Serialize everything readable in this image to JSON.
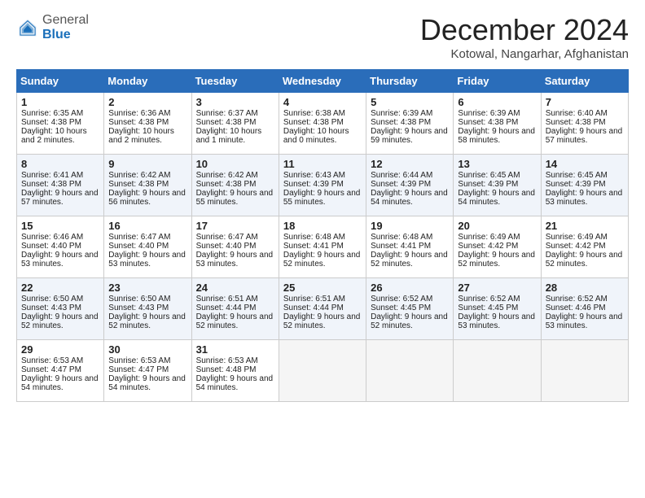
{
  "logo": {
    "general": "General",
    "blue": "Blue"
  },
  "title": "December 2024",
  "location": "Kotowal, Nangarhar, Afghanistan",
  "headers": [
    "Sunday",
    "Monday",
    "Tuesday",
    "Wednesday",
    "Thursday",
    "Friday",
    "Saturday"
  ],
  "weeks": [
    [
      {
        "day": "1",
        "sunrise": "Sunrise: 6:35 AM",
        "sunset": "Sunset: 4:38 PM",
        "daylight": "Daylight: 10 hours and 2 minutes."
      },
      {
        "day": "2",
        "sunrise": "Sunrise: 6:36 AM",
        "sunset": "Sunset: 4:38 PM",
        "daylight": "Daylight: 10 hours and 2 minutes."
      },
      {
        "day": "3",
        "sunrise": "Sunrise: 6:37 AM",
        "sunset": "Sunset: 4:38 PM",
        "daylight": "Daylight: 10 hours and 1 minute."
      },
      {
        "day": "4",
        "sunrise": "Sunrise: 6:38 AM",
        "sunset": "Sunset: 4:38 PM",
        "daylight": "Daylight: 10 hours and 0 minutes."
      },
      {
        "day": "5",
        "sunrise": "Sunrise: 6:39 AM",
        "sunset": "Sunset: 4:38 PM",
        "daylight": "Daylight: 9 hours and 59 minutes."
      },
      {
        "day": "6",
        "sunrise": "Sunrise: 6:39 AM",
        "sunset": "Sunset: 4:38 PM",
        "daylight": "Daylight: 9 hours and 58 minutes."
      },
      {
        "day": "7",
        "sunrise": "Sunrise: 6:40 AM",
        "sunset": "Sunset: 4:38 PM",
        "daylight": "Daylight: 9 hours and 57 minutes."
      }
    ],
    [
      {
        "day": "8",
        "sunrise": "Sunrise: 6:41 AM",
        "sunset": "Sunset: 4:38 PM",
        "daylight": "Daylight: 9 hours and 57 minutes."
      },
      {
        "day": "9",
        "sunrise": "Sunrise: 6:42 AM",
        "sunset": "Sunset: 4:38 PM",
        "daylight": "Daylight: 9 hours and 56 minutes."
      },
      {
        "day": "10",
        "sunrise": "Sunrise: 6:42 AM",
        "sunset": "Sunset: 4:38 PM",
        "daylight": "Daylight: 9 hours and 55 minutes."
      },
      {
        "day": "11",
        "sunrise": "Sunrise: 6:43 AM",
        "sunset": "Sunset: 4:39 PM",
        "daylight": "Daylight: 9 hours and 55 minutes."
      },
      {
        "day": "12",
        "sunrise": "Sunrise: 6:44 AM",
        "sunset": "Sunset: 4:39 PM",
        "daylight": "Daylight: 9 hours and 54 minutes."
      },
      {
        "day": "13",
        "sunrise": "Sunrise: 6:45 AM",
        "sunset": "Sunset: 4:39 PM",
        "daylight": "Daylight: 9 hours and 54 minutes."
      },
      {
        "day": "14",
        "sunrise": "Sunrise: 6:45 AM",
        "sunset": "Sunset: 4:39 PM",
        "daylight": "Daylight: 9 hours and 53 minutes."
      }
    ],
    [
      {
        "day": "15",
        "sunrise": "Sunrise: 6:46 AM",
        "sunset": "Sunset: 4:40 PM",
        "daylight": "Daylight: 9 hours and 53 minutes."
      },
      {
        "day": "16",
        "sunrise": "Sunrise: 6:47 AM",
        "sunset": "Sunset: 4:40 PM",
        "daylight": "Daylight: 9 hours and 53 minutes."
      },
      {
        "day": "17",
        "sunrise": "Sunrise: 6:47 AM",
        "sunset": "Sunset: 4:40 PM",
        "daylight": "Daylight: 9 hours and 53 minutes."
      },
      {
        "day": "18",
        "sunrise": "Sunrise: 6:48 AM",
        "sunset": "Sunset: 4:41 PM",
        "daylight": "Daylight: 9 hours and 52 minutes."
      },
      {
        "day": "19",
        "sunrise": "Sunrise: 6:48 AM",
        "sunset": "Sunset: 4:41 PM",
        "daylight": "Daylight: 9 hours and 52 minutes."
      },
      {
        "day": "20",
        "sunrise": "Sunrise: 6:49 AM",
        "sunset": "Sunset: 4:42 PM",
        "daylight": "Daylight: 9 hours and 52 minutes."
      },
      {
        "day": "21",
        "sunrise": "Sunrise: 6:49 AM",
        "sunset": "Sunset: 4:42 PM",
        "daylight": "Daylight: 9 hours and 52 minutes."
      }
    ],
    [
      {
        "day": "22",
        "sunrise": "Sunrise: 6:50 AM",
        "sunset": "Sunset: 4:43 PM",
        "daylight": "Daylight: 9 hours and 52 minutes."
      },
      {
        "day": "23",
        "sunrise": "Sunrise: 6:50 AM",
        "sunset": "Sunset: 4:43 PM",
        "daylight": "Daylight: 9 hours and 52 minutes."
      },
      {
        "day": "24",
        "sunrise": "Sunrise: 6:51 AM",
        "sunset": "Sunset: 4:44 PM",
        "daylight": "Daylight: 9 hours and 52 minutes."
      },
      {
        "day": "25",
        "sunrise": "Sunrise: 6:51 AM",
        "sunset": "Sunset: 4:44 PM",
        "daylight": "Daylight: 9 hours and 52 minutes."
      },
      {
        "day": "26",
        "sunrise": "Sunrise: 6:52 AM",
        "sunset": "Sunset: 4:45 PM",
        "daylight": "Daylight: 9 hours and 52 minutes."
      },
      {
        "day": "27",
        "sunrise": "Sunrise: 6:52 AM",
        "sunset": "Sunset: 4:45 PM",
        "daylight": "Daylight: 9 hours and 53 minutes."
      },
      {
        "day": "28",
        "sunrise": "Sunrise: 6:52 AM",
        "sunset": "Sunset: 4:46 PM",
        "daylight": "Daylight: 9 hours and 53 minutes."
      }
    ],
    [
      {
        "day": "29",
        "sunrise": "Sunrise: 6:53 AM",
        "sunset": "Sunset: 4:47 PM",
        "daylight": "Daylight: 9 hours and 54 minutes."
      },
      {
        "day": "30",
        "sunrise": "Sunrise: 6:53 AM",
        "sunset": "Sunset: 4:47 PM",
        "daylight": "Daylight: 9 hours and 54 minutes."
      },
      {
        "day": "31",
        "sunrise": "Sunrise: 6:53 AM",
        "sunset": "Sunset: 4:48 PM",
        "daylight": "Daylight: 9 hours and 54 minutes."
      },
      null,
      null,
      null,
      null
    ]
  ]
}
